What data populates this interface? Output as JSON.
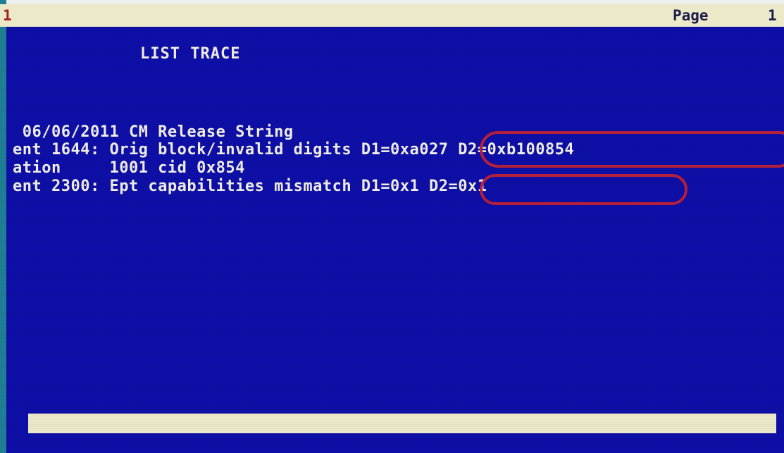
{
  "header": {
    "left_number": "1",
    "page_label": "Page",
    "page_number": "1"
  },
  "title": "LIST TRACE",
  "trace_lines": [
    " 06/06/2011 CM Release String",
    "ent 1644: Orig block/invalid digits D1=0xa027 D2=0xb100854",
    "ation     1001 cid 0x854",
    "ent 2300: Ept capabilities mismatch D1=0x1 D2=0x1"
  ],
  "colors": {
    "screen_background": "#0e0fa6",
    "text": "#f2f0e6",
    "bar": "#ece9c9",
    "highlight_oval": "#b8203a"
  }
}
